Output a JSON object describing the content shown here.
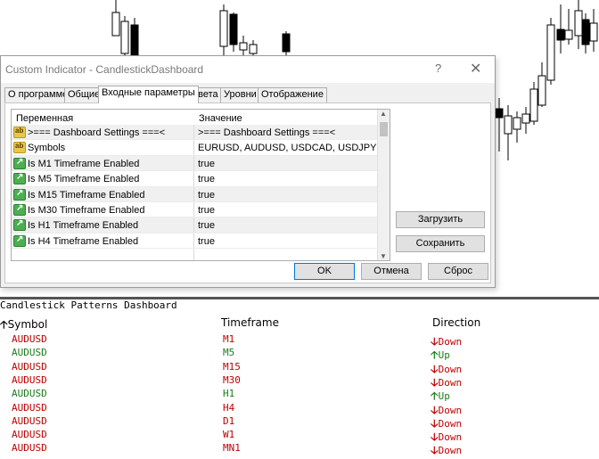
{
  "dialog": {
    "title": "Custom Indicator - CandlestickDashboard",
    "help": "?",
    "close": "✕",
    "tabs": [
      "О программе",
      "Общие",
      "Входные параметры",
      "Цвета",
      "Уровни",
      "Отображение"
    ],
    "active_tab": 2,
    "columns": [
      "Переменная",
      "Значение"
    ],
    "params": [
      {
        "icon": "string-param-icon",
        "name": ">=== Dashboard Settings ===<",
        "value": ">=== Dashboard Settings ===<"
      },
      {
        "icon": "string-param-icon",
        "name": "Symbols",
        "value": "EURUSD, AUDUSD, USDCAD, USDJPY"
      },
      {
        "icon": "bool-param-icon",
        "name": "Is M1 Timeframe Enabled",
        "value": "true"
      },
      {
        "icon": "bool-param-icon",
        "name": "Is M5 Timeframe Enabled",
        "value": "true"
      },
      {
        "icon": "bool-param-icon",
        "name": "Is M15 Timeframe Enabled",
        "value": "true"
      },
      {
        "icon": "bool-param-icon",
        "name": "Is M30 Timeframe Enabled",
        "value": "true"
      },
      {
        "icon": "bool-param-icon",
        "name": "Is H1 Timeframe Enabled",
        "value": "true"
      },
      {
        "icon": "bool-param-icon",
        "name": "Is H4 Timeframe Enabled",
        "value": "true"
      }
    ],
    "load_label": "Загрузить",
    "save_label": "Сохранить",
    "ok_label": "OK",
    "cancel_label": "Отмена",
    "reset_label": "Сброс"
  },
  "dashboard": {
    "title": "Candlestick Patterns Dashboard",
    "sort_arrow": "🡡",
    "headers": [
      "Symbol",
      "Timeframe",
      "Direction"
    ],
    "rows": [
      {
        "symbol": "AUDUSD",
        "timeframe": "M1",
        "arrow": "🡣",
        "direction": "Down",
        "dir": "down"
      },
      {
        "symbol": "AUDUSD",
        "timeframe": "M5",
        "arrow": "🡡",
        "direction": "Up",
        "dir": "up"
      },
      {
        "symbol": "AUDUSD",
        "timeframe": "M15",
        "arrow": "🡣",
        "direction": "Down",
        "dir": "down"
      },
      {
        "symbol": "AUDUSD",
        "timeframe": "M30",
        "arrow": "🡣",
        "direction": "Down",
        "dir": "down"
      },
      {
        "symbol": "AUDUSD",
        "timeframe": "H1",
        "arrow": "🡡",
        "direction": "Up",
        "dir": "up"
      },
      {
        "symbol": "AUDUSD",
        "timeframe": "H4",
        "arrow": "🡣",
        "direction": "Down",
        "dir": "down"
      },
      {
        "symbol": "AUDUSD",
        "timeframe": "D1",
        "arrow": "🡣",
        "direction": "Down",
        "dir": "down"
      },
      {
        "symbol": "AUDUSD",
        "timeframe": "W1",
        "arrow": "🡣",
        "direction": "Down",
        "dir": "down"
      },
      {
        "symbol": "AUDUSD",
        "timeframe": "MN1",
        "arrow": "🡣",
        "direction": "Down",
        "dir": "down"
      }
    ],
    "colors": {
      "up": "#1b7a1b",
      "down": "#c00000"
    }
  }
}
